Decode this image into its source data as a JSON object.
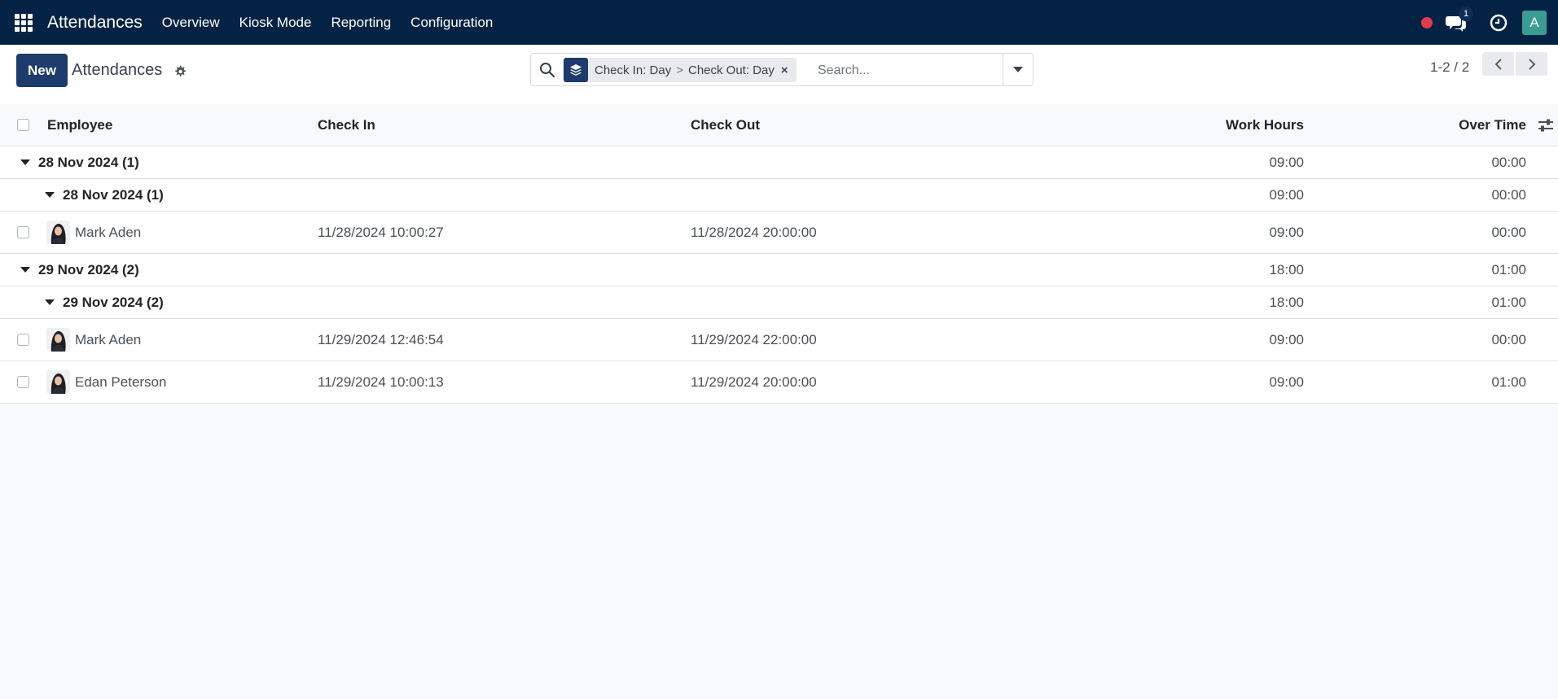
{
  "navbar": {
    "app_title": "Attendances",
    "menu": [
      "Overview",
      "Kiosk Mode",
      "Reporting",
      "Configuration"
    ],
    "chat_count": "1",
    "user_initial": "A",
    "colors": {
      "bg": "#042344",
      "record": "#e23b4a",
      "avatar": "#3a9c93"
    }
  },
  "control": {
    "new_label": "New",
    "title": "Attendances",
    "facet": {
      "part1": "Check In: Day",
      "separator": ">",
      "part2": "Check Out: Day",
      "close": "×"
    },
    "search_placeholder": "Search...",
    "pager": "1-2 / 2"
  },
  "columns": [
    "Employee",
    "Check In",
    "Check Out",
    "Work Hours",
    "Over Time"
  ],
  "groups": [
    {
      "label": "28 Nov 2024 (1)",
      "work": "09:00",
      "over": "00:00",
      "sub": {
        "label": "28 Nov 2024 (1)",
        "work": "09:00",
        "over": "00:00",
        "records": [
          {
            "employee": "Mark Aden",
            "check_in": "11/28/2024 10:00:27",
            "check_out": "11/28/2024 20:00:00",
            "work": "09:00",
            "over": "00:00"
          }
        ]
      }
    },
    {
      "label": "29 Nov 2024 (2)",
      "work": "18:00",
      "over": "01:00",
      "sub": {
        "label": "29 Nov 2024 (2)",
        "work": "18:00",
        "over": "01:00",
        "records": [
          {
            "employee": "Mark Aden",
            "check_in": "11/29/2024 12:46:54",
            "check_out": "11/29/2024 22:00:00",
            "work": "09:00",
            "over": "00:00"
          },
          {
            "employee": "Edan Peterson",
            "check_in": "11/29/2024 10:00:13",
            "check_out": "11/29/2024 20:00:00",
            "work": "09:00",
            "over": "01:00"
          }
        ]
      }
    }
  ]
}
